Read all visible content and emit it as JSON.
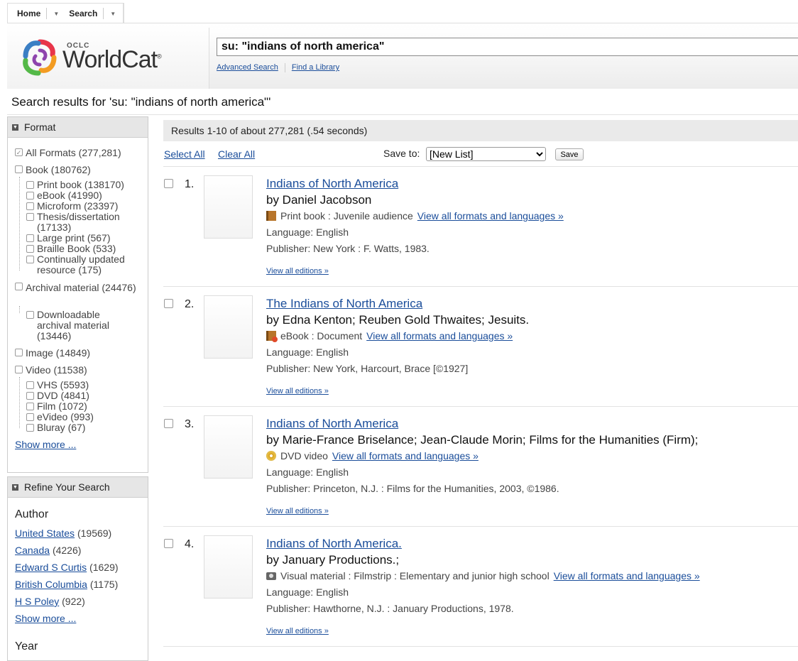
{
  "nav": {
    "home": "Home",
    "search": "Search"
  },
  "logo": {
    "oclc": "OCLC",
    "name": "WorldCat",
    "reg": "®"
  },
  "search": {
    "query": "su: \"indians of north america\"",
    "advanced": "Advanced Search",
    "find_library": "Find a Library"
  },
  "results_title": "Search results for 'su: \"indians of north america\"'",
  "format": {
    "title": "Format",
    "items": [
      "All Formats (277,281)",
      "Book (180762)",
      "Print book (138170)",
      "eBook (41990)",
      "Microform (23397)",
      "Thesis/dissertation (17133)",
      "Large print (567)",
      "Braille Book (533)",
      "Continually updated resource (175)",
      "Archival material (24476)",
      "Downloadable archival material (13446)",
      "Image (14849)",
      "Video (11538)",
      "VHS (5593)",
      "DVD (4841)",
      "Film (1072)",
      "eVideo (993)",
      "Bluray (67)"
    ],
    "show_more": "Show more ..."
  },
  "refine": {
    "title": "Refine Your Search",
    "author_heading": "Author",
    "authors": [
      {
        "name": "United States",
        "count": "(19569)"
      },
      {
        "name": "Canada",
        "count": "(4226)"
      },
      {
        "name": "Edward S Curtis",
        "count": "(1629)"
      },
      {
        "name": "British Columbia",
        "count": "(1175)"
      },
      {
        "name": "H S Poley",
        "count": "(922)"
      }
    ],
    "show_more": "Show more ...",
    "year_heading": "Year"
  },
  "results_summary": "Results 1-10 of about 277,281 (.54 seconds)",
  "controls": {
    "select_all": "Select All",
    "clear_all": "Clear All",
    "save_to": "Save to:",
    "list_option": "[New List]",
    "save": "Save"
  },
  "records": [
    {
      "num": "1.",
      "title": "Indians of North America",
      "author": "by Daniel Jacobson",
      "format": "Print book : Juvenile audience",
      "icon": "book-icon",
      "view_formats": "View all formats and languages »",
      "language": "Language: English",
      "publisher": "Publisher: New York : F. Watts, 1983.",
      "editions": "View all editions »"
    },
    {
      "num": "2.",
      "title": "The Indians of North America",
      "author": "by Edna Kenton; Reuben Gold Thwaites; Jesuits.",
      "format": "eBook : Document",
      "icon": "ebook-icon",
      "view_formats": "View all formats and languages »",
      "language": "Language: English",
      "publisher": "Publisher: New York, Harcourt, Brace [©1927]",
      "editions": "View all editions »"
    },
    {
      "num": "3.",
      "title": "Indians of North America",
      "author": "by Marie-France Briselance; Jean-Claude Morin; Films for the Humanities (Firm);",
      "format": "DVD video",
      "icon": "dvd-icon",
      "view_formats": "View all formats and languages »",
      "language": "Language: English",
      "publisher": "Publisher: Princeton, N.J. : Films for the Humanities, 2003, ©1986.",
      "editions": "View all editions »"
    },
    {
      "num": "4.",
      "title": "Indians of North America.",
      "author": "by January Productions.;",
      "format": "Visual material : Filmstrip : Elementary and junior high school",
      "icon": "camera-icon",
      "view_formats": "View all formats and languages »",
      "language": "Language: English",
      "publisher": "Publisher: Hawthorne, N.J. : January Productions, 1978.",
      "editions": "View all editions »"
    }
  ]
}
